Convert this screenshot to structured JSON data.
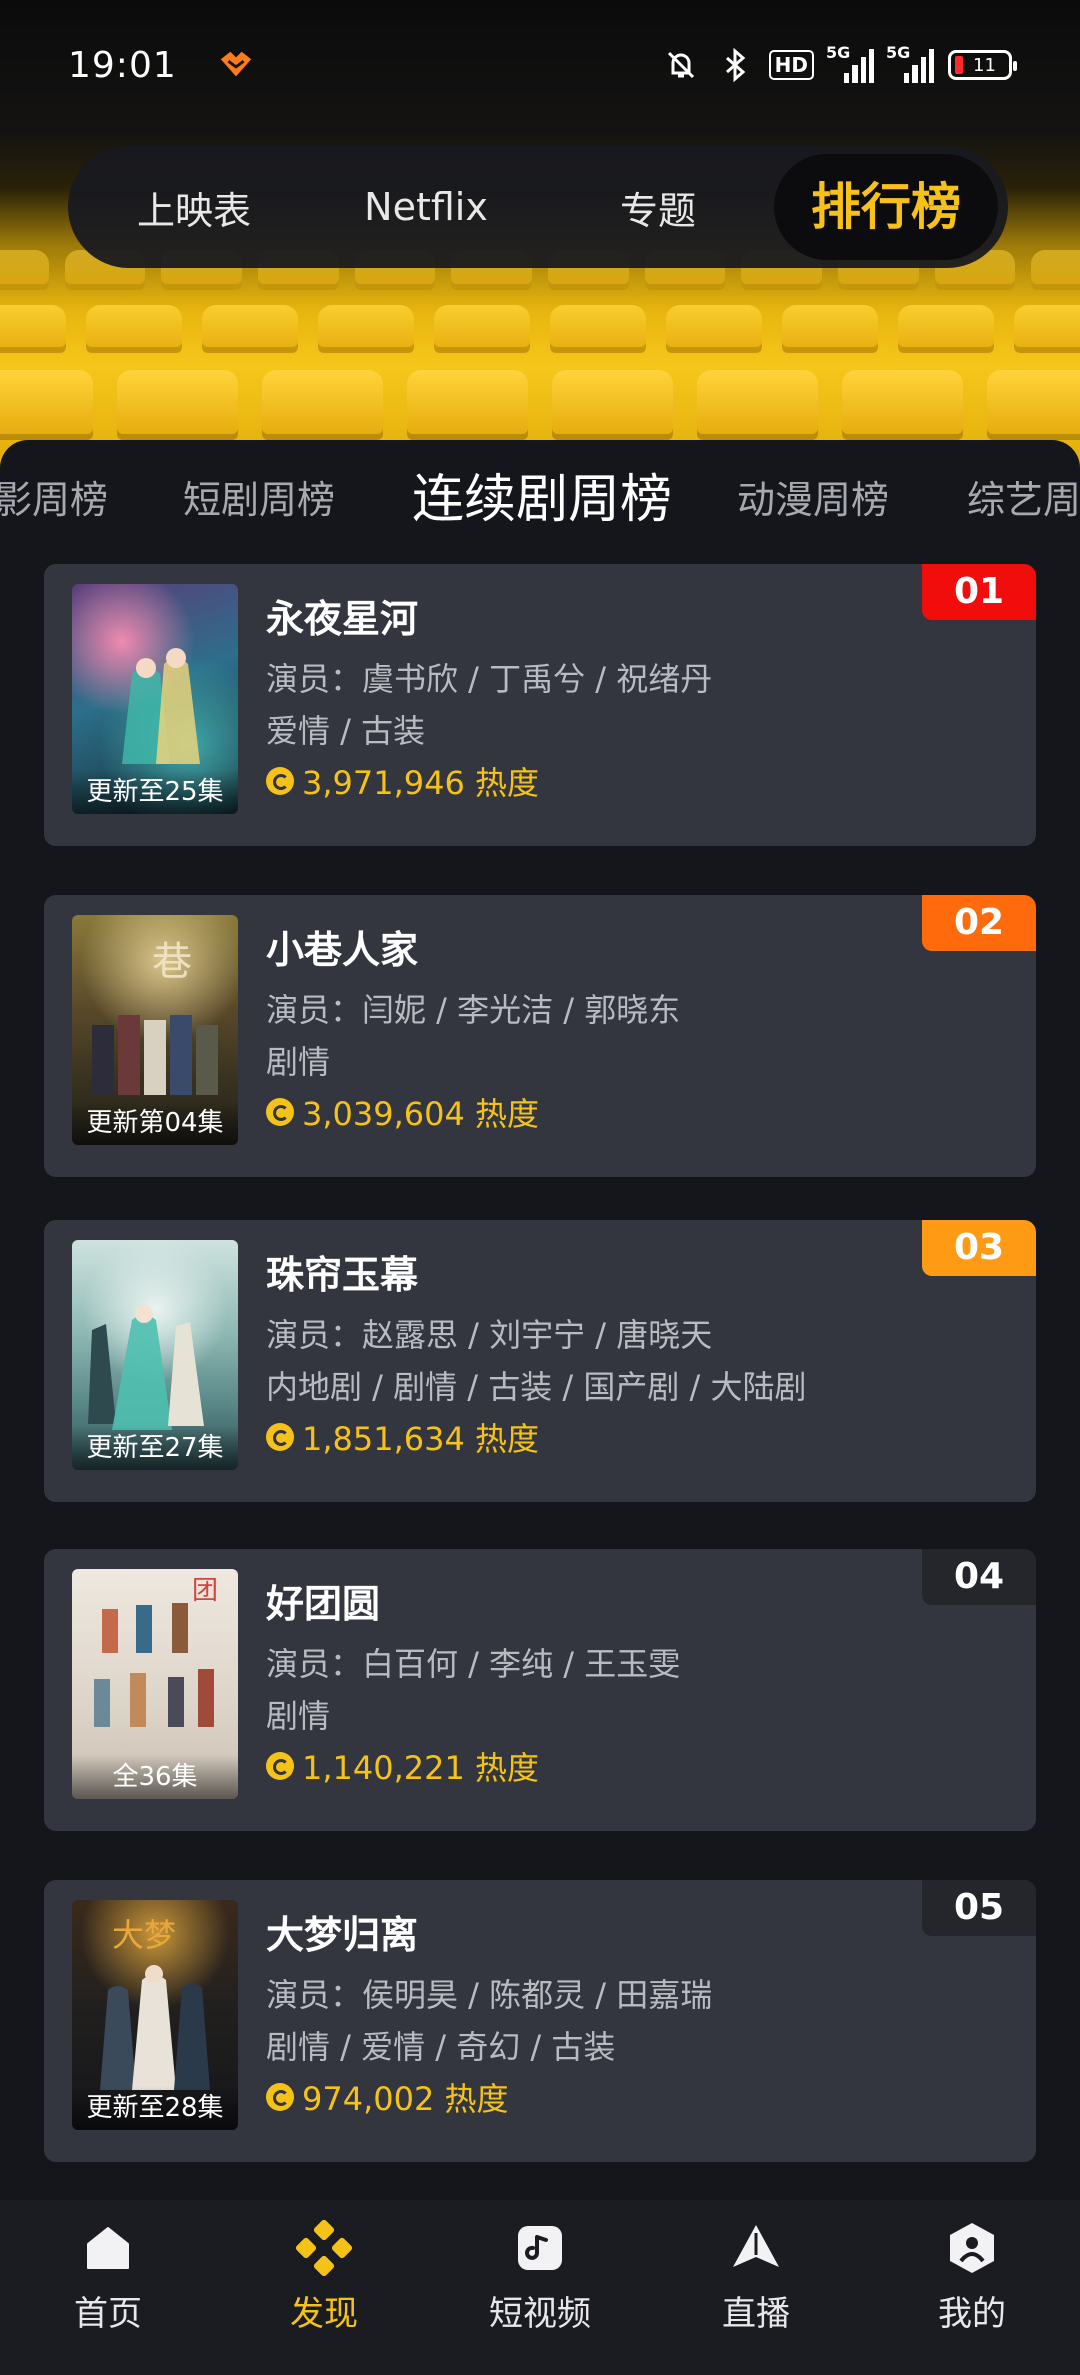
{
  "status_bar": {
    "time": "19:01",
    "hd": "HD",
    "signal1": "5G",
    "signal2": "5G",
    "battery": "11"
  },
  "top_tabs": [
    {
      "label": "上映表",
      "active": false
    },
    {
      "label": "Netflix",
      "active": false
    },
    {
      "label": "专题",
      "active": false
    },
    {
      "label": "排行榜",
      "active": true
    }
  ],
  "sub_tabs": [
    {
      "label": "影周榜",
      "active": false
    },
    {
      "label": "短剧周榜",
      "active": false
    },
    {
      "label": "连续剧周榜",
      "active": true
    },
    {
      "label": "动漫周榜",
      "active": false
    },
    {
      "label": "综艺周",
      "active": false
    }
  ],
  "items": [
    {
      "rank": "01",
      "title": "永夜星河",
      "cast": "演员：虞书欣 / 丁禹兮 / 祝绪丹",
      "genre": "爱情 / 古装",
      "heat": "3,971,946 热度",
      "episode": "更新至25集"
    },
    {
      "rank": "02",
      "title": "小巷人家",
      "cast": "演员：闫妮 / 李光洁 / 郭晓东",
      "genre": "剧情",
      "heat": "3,039,604 热度",
      "episode": "更新第04集"
    },
    {
      "rank": "03",
      "title": "珠帘玉幕",
      "cast": "演员：赵露思 / 刘宇宁 / 唐晓天",
      "genre": "内地剧 / 剧情 / 古装 / 国产剧 / 大陆剧",
      "heat": "1,851,634 热度",
      "episode": "更新至27集"
    },
    {
      "rank": "04",
      "title": "好团圆",
      "cast": "演员：白百何 / 李纯 / 王玉雯",
      "genre": "剧情",
      "heat": "1,140,221 热度",
      "episode": "全36集"
    },
    {
      "rank": "05",
      "title": "大梦归离",
      "cast": "演员：侯明昊 / 陈都灵 / 田嘉瑞",
      "genre": "剧情 / 爱情 / 奇幻 / 古装",
      "heat": "974,002 热度",
      "episode": "更新至28集"
    }
  ],
  "bottom_nav": [
    {
      "label": "首页",
      "icon": "home-icon",
      "active": false
    },
    {
      "label": "发现",
      "icon": "discover-icon",
      "active": true
    },
    {
      "label": "短视频",
      "icon": "short-video-icon",
      "active": false
    },
    {
      "label": "直播",
      "icon": "live-icon",
      "active": false
    },
    {
      "label": "我的",
      "icon": "profile-icon",
      "active": false
    }
  ],
  "colors": {
    "accent": "#f5c318",
    "rank1": "#f20d0d",
    "rank2": "#ff6a0d",
    "rank3": "#ff9a14",
    "card": "#33353f",
    "background": "#14161c"
  }
}
